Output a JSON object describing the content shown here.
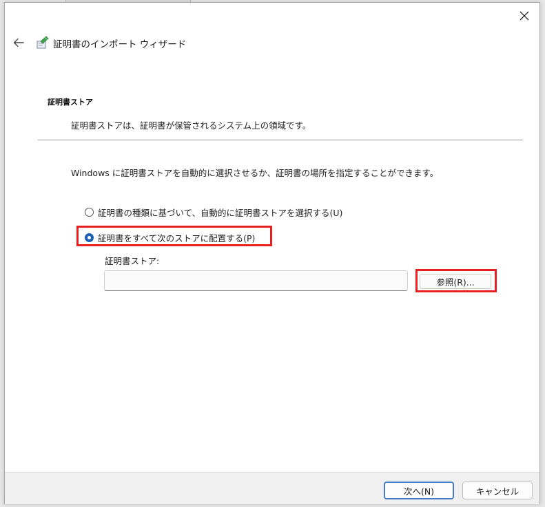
{
  "wizard": {
    "title": "証明書のインポート ウィザード"
  },
  "section": {
    "title": "証明書ストア",
    "description": "証明書ストアは、証明書が保管されるシステム上の領域です。"
  },
  "intro": "Windows に証明書ストアを自動的に選択させるか、証明書の場所を指定することができます。",
  "options": {
    "auto": {
      "label": "証明書の種類に基づいて、自動的に証明書ストアを選択する(U)",
      "selected": false
    },
    "manual": {
      "label": "証明書をすべて次のストアに配置する(P)",
      "selected": true
    }
  },
  "store": {
    "label": "証明書ストア:",
    "value": "",
    "browse_label": "参照(R)..."
  },
  "footer": {
    "next_label": "次へ(N)",
    "cancel_label": "キャンセル"
  },
  "colors": {
    "accent": "#1a5fb4",
    "highlight": "#e81f1f"
  },
  "icons": {
    "close": "close-icon",
    "back": "back-arrow-icon",
    "wizard": "certificate-icon"
  }
}
